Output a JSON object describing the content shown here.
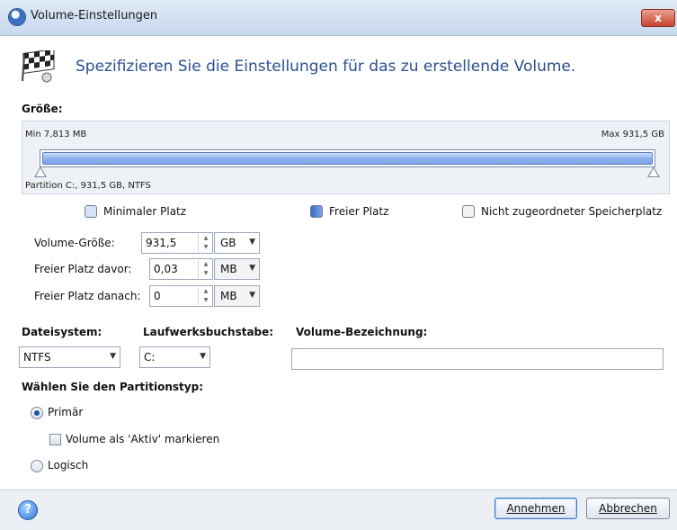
{
  "window": {
    "title": "Volume-Einstellungen",
    "close_label": "x"
  },
  "header": {
    "headline": "Spezifizieren Sie die Einstellungen für das zu erstellende Volume."
  },
  "size": {
    "section_label": "Größe:",
    "min_label": "Min 7,813 MB",
    "max_label": "Max 931,5 GB",
    "partition_label": "Partition C:, 931,5 GB, NTFS",
    "fill_fraction": 1.0
  },
  "legend": {
    "items": [
      {
        "label": "Minimaler Platz",
        "color": "#b9cbe6"
      },
      {
        "label": "Freier Platz",
        "color": "#4d7ed1"
      },
      {
        "label": "Nicht zugeordneter Speicherplatz",
        "color": "#eaeaea"
      }
    ]
  },
  "fields": {
    "volume_size": {
      "label": "Volume-Größe:",
      "value": "931,5",
      "unit": "GB"
    },
    "free_before": {
      "label": "Freier Platz davor:",
      "value": "0,03",
      "unit": "MB"
    },
    "free_after": {
      "label": "Freier Platz danach:",
      "value": "0",
      "unit": "MB"
    }
  },
  "filesystem": {
    "label": "Dateisystem:",
    "value": "NTFS"
  },
  "drive_letter": {
    "label": "Laufwerksbuchstabe:",
    "value": "C:"
  },
  "volume_label": {
    "label": "Volume-Bezeichnung:",
    "value": ""
  },
  "partition_type": {
    "label": "Wählen Sie den Partitionstyp:",
    "primary": "Primär",
    "active_checkbox": "Volume als 'Aktiv' markieren",
    "logical": "Logisch",
    "selected": "Primär"
  },
  "footer": {
    "help_label": "?",
    "ok_label": "Annehmen",
    "cancel_label": "Abbrechen"
  }
}
